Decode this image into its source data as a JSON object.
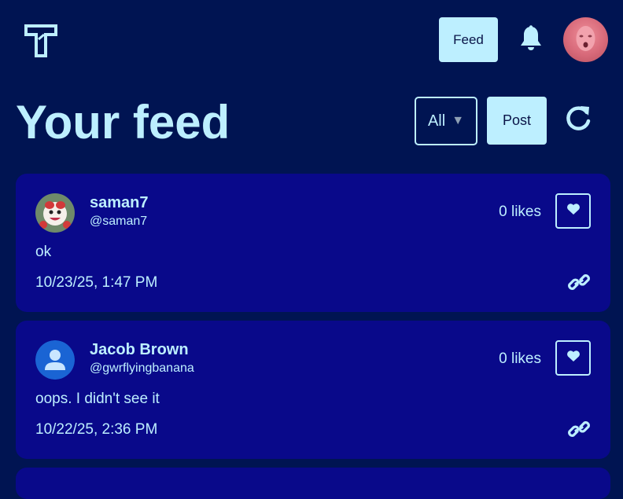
{
  "header": {
    "logo_icon": "t-logo-icon",
    "nav_feed_label": "Feed",
    "bell_icon": "bell-icon"
  },
  "page": {
    "title": "Your feed",
    "filter_value": "All",
    "post_label": "Post",
    "refresh_icon": "refresh-icon"
  },
  "posts": [
    {
      "name": "saman7",
      "handle": "@saman7",
      "likes": "0 likes",
      "text": "ok",
      "date": "10/23/25, 1:47 PM"
    },
    {
      "name": "Jacob Brown",
      "handle": "@gwrflyingbanana",
      "likes": "0 likes",
      "text": "oops. I didn't see it",
      "date": "10/22/25, 2:36 PM"
    }
  ],
  "colors": {
    "background": "#001452",
    "card": "#09098a",
    "accent": "#bdefff"
  }
}
